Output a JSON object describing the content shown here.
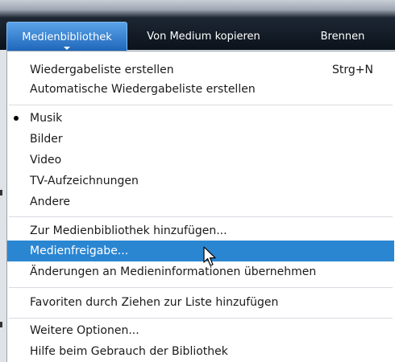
{
  "tabs": [
    {
      "label": "Medienbibliothek",
      "active": true
    },
    {
      "label": "Von Medium kopieren",
      "active": false
    },
    {
      "label": "Brennen",
      "active": false
    }
  ],
  "menu": {
    "group1": [
      {
        "label": "Wiedergabeliste erstellen",
        "shortcut": "Strg+N"
      },
      {
        "label": "Automatische Wiedergabeliste erstellen"
      }
    ],
    "group2": [
      {
        "label": "Musik",
        "checked": true
      },
      {
        "label": "Bilder"
      },
      {
        "label": "Video"
      },
      {
        "label": "TV-Aufzeichnungen"
      },
      {
        "label": "Andere"
      }
    ],
    "group3": [
      {
        "label": "Zur Medienbibliothek hinzufügen..."
      },
      {
        "label": "Medienfreigabe...",
        "highlighted": true
      },
      {
        "label": "Änderungen an Medieninformationen übernehmen"
      }
    ],
    "group4": [
      {
        "label": "Favoriten durch Ziehen zur Liste hinzufügen"
      }
    ],
    "group5": [
      {
        "label": "Weitere Optionen..."
      },
      {
        "label": "Hilfe beim Gebrauch der Bibliothek"
      }
    ]
  },
  "colors": {
    "highlight": "#2b86d2",
    "tab_active": "#1c63b8",
    "topbar": "#0b121b"
  },
  "icons": {
    "cursor": "mouse-pointer-icon",
    "caret": "caret-down-icon",
    "bullet": "radio-bullet-icon"
  }
}
